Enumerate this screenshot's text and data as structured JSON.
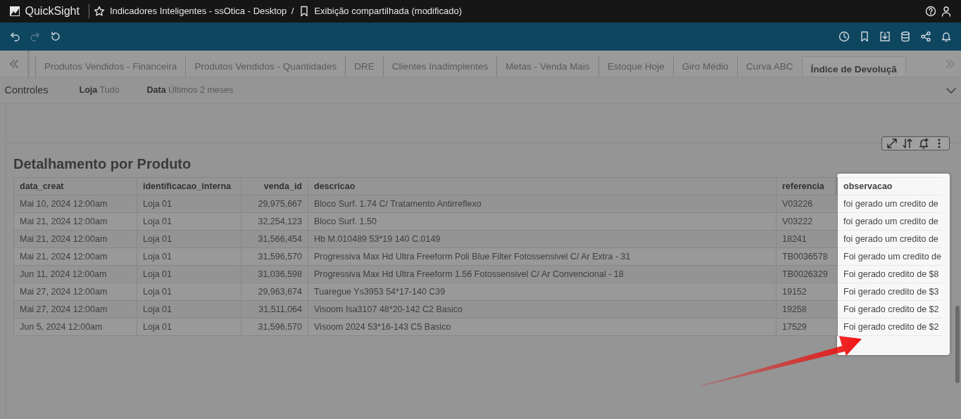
{
  "app": {
    "name": "QuickSight"
  },
  "breadcrumb": {
    "dashboard": "Indicadores Inteligentes - ssOtica - Desktop",
    "separator": "/",
    "view": "Exibição compartilhada (modificado)"
  },
  "toolbar": {
    "redo_disabled": true
  },
  "sheet_tabs": [
    {
      "label": "Produtos Vendidos - Financeira",
      "selected": false
    },
    {
      "label": "Produtos Vendidos - Quantidades",
      "selected": false
    },
    {
      "label": "DRE",
      "selected": false
    },
    {
      "label": "Clientes Inadimplentes",
      "selected": false
    },
    {
      "label": "Metas - Venda Mais",
      "selected": false
    },
    {
      "label": "Estoque Hoje",
      "selected": false
    },
    {
      "label": "Giro Médio",
      "selected": false
    },
    {
      "label": "Curva ABC",
      "selected": false
    },
    {
      "label": "Índice de Devoluçã",
      "selected": true
    }
  ],
  "controls": {
    "title": "Controles",
    "filters": [
      {
        "label": "Loja",
        "value": "Tudo"
      },
      {
        "label": "Data",
        "value": "Últimos 2 meses"
      }
    ]
  },
  "visual": {
    "title": "Detalhamento por Produto",
    "columns": [
      {
        "label": "data_creat",
        "kind": "text",
        "highlighted": false
      },
      {
        "label": "identificacao_interna",
        "kind": "text",
        "highlighted": false
      },
      {
        "label": "venda_id",
        "kind": "number",
        "highlighted": false
      },
      {
        "label": "descricao",
        "kind": "text",
        "highlighted": false
      },
      {
        "label": "referencia",
        "kind": "text",
        "highlighted": false
      },
      {
        "label": "observacao",
        "kind": "text",
        "highlighted": true
      }
    ],
    "rows": [
      [
        "Mai 10, 2024 12:00am",
        "Loja 01",
        "29,975,667",
        "Bloco Surf. 1.74 C/ Tratamento Antirreflexo",
        "V03226",
        "foi gerado um credito de"
      ],
      [
        "Mai 21, 2024 12:00am",
        "Loja 01",
        "32,254,123",
        "Bloco Surf. 1.50",
        "V03222",
        "foi gerado um credito de"
      ],
      [
        "Mai 21, 2024 12:00am",
        "Loja 01",
        "31,566,454",
        "Hb M.010489 53*19 140 C.0149",
        "18241",
        "foi gerado um credito de"
      ],
      [
        "Mai 21, 2024 12:00am",
        "Loja 01",
        "31,596,570",
        "Progressiva Max Hd Ultra Freeform Poli Blue Filter Fotossensivel C/ Ar Extra - 31",
        "TB0036578",
        "Foi gerado um credito de"
      ],
      [
        "Jun 11, 2024 12:00am",
        "Loja 01",
        "31,036,598",
        "Progressiva Max Hd Ultra Freeform 1.56 Fotossensivel C/ Ar Convencional - 18",
        "TB0026329",
        "Foi gerado credito de $8"
      ],
      [
        "Mai 27, 2024 12:00am",
        "Loja 01",
        "29,963,674",
        "Tuaregue Ys3953 54*17-140 C39",
        "19152",
        "Foi gerado credito de $3"
      ],
      [
        "Mai 27, 2024 12:00am",
        "Loja 01",
        "31,511,064",
        "Visoom Isa3107 48*20-142 C2 Basico",
        "19258",
        "Foi gerado credito de $2"
      ],
      [
        "Jun 5, 2024 12:00am",
        "Loja 01",
        "31,596,570",
        "Visoom 2024 53*16-143 C5 Basico",
        "17529",
        "Foi gerado credito de $2"
      ]
    ]
  }
}
